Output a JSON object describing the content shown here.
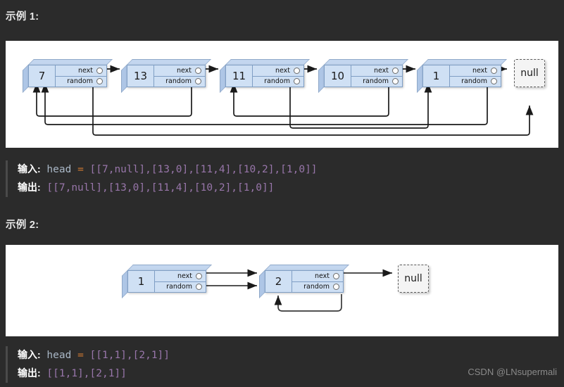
{
  "page": {
    "background": "#2b2b2b",
    "panel_background": "#ffffff",
    "node_fill": "#cfe0f4",
    "node_border": "#7f9ec4",
    "watermark": "CSDN @LNsupermali"
  },
  "examples": [
    {
      "title": "示例 1:",
      "input_label": "输入:",
      "input_var": "head",
      "input_eq": "=",
      "input_value": "[[7,null],[13,0],[11,4],[10,2],[1,0]]",
      "output_label": "输出:",
      "output_value": "[[7,null],[13,0],[11,4],[10,2],[1,0]]",
      "diagram": {
        "next_field_label": "next",
        "random_field_label": "random",
        "null_label": "null",
        "nodes": [
          {
            "value": "7",
            "index": 0,
            "random_target": "null"
          },
          {
            "value": "13",
            "index": 1,
            "random_target": "0"
          },
          {
            "value": "11",
            "index": 2,
            "random_target": "4"
          },
          {
            "value": "10",
            "index": 3,
            "random_target": "2"
          },
          {
            "value": "1",
            "index": 4,
            "random_target": "0"
          }
        ]
      }
    },
    {
      "title": "示例 2:",
      "input_label": "输入:",
      "input_var": "head",
      "input_eq": "=",
      "input_value": "[[1,1],[2,1]]",
      "output_label": "输出:",
      "output_value": "[[1,1],[2,1]]",
      "diagram": {
        "next_field_label": "next",
        "random_field_label": "random",
        "null_label": "null",
        "nodes": [
          {
            "value": "1",
            "index": 0,
            "random_target": "1"
          },
          {
            "value": "2",
            "index": 1,
            "random_target": "1"
          }
        ]
      }
    }
  ]
}
